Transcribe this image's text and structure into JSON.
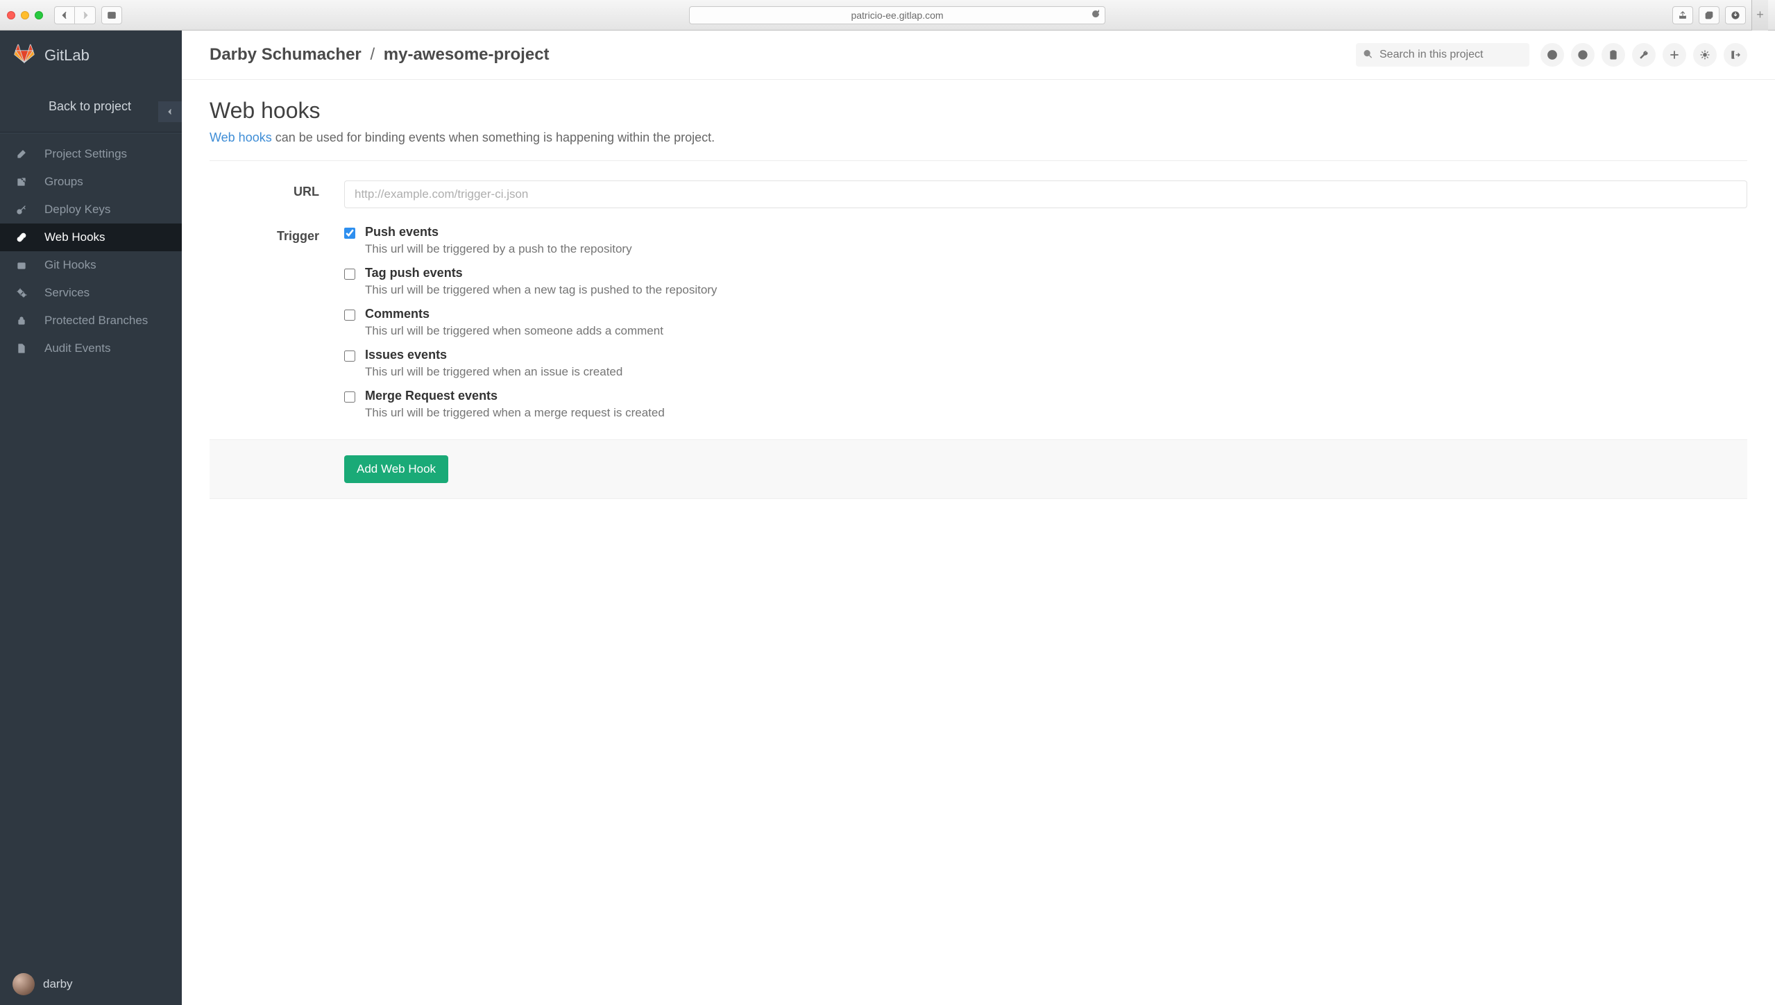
{
  "browser": {
    "url": "patricio-ee.gitlap.com"
  },
  "sidebar": {
    "brand": "GitLab",
    "back_label": "Back to project",
    "items": [
      {
        "icon": "edit-icon",
        "label": "Project Settings"
      },
      {
        "icon": "share-icon",
        "label": "Groups"
      },
      {
        "icon": "key-icon",
        "label": "Deploy Keys"
      },
      {
        "icon": "link-icon",
        "label": "Web Hooks",
        "active": true
      },
      {
        "icon": "hook-icon",
        "label": "Git Hooks"
      },
      {
        "icon": "cogs-icon",
        "label": "Services"
      },
      {
        "icon": "lock-icon",
        "label": "Protected Branches"
      },
      {
        "icon": "file-icon",
        "label": "Audit Events"
      }
    ],
    "user": "darby"
  },
  "topbar": {
    "breadcrumb_owner": "Darby Schumacher",
    "breadcrumb_project": "my-awesome-project",
    "search_placeholder": "Search in this project",
    "icon_buttons": [
      "help-icon",
      "globe-icon",
      "clipboard-icon",
      "wrench-icon",
      "plus-icon",
      "gear-icon",
      "logout-icon"
    ]
  },
  "page": {
    "title": "Web hooks",
    "subtitle_link": "Web hooks",
    "subtitle_rest": " can be used for binding events when something is happening within the project.",
    "form": {
      "url_label": "URL",
      "url_placeholder": "http://example.com/trigger-ci.json",
      "trigger_label": "Trigger",
      "submit_label": "Add Web Hook",
      "triggers": [
        {
          "checked": true,
          "title": "Push events",
          "desc": "This url will be triggered by a push to the repository"
        },
        {
          "checked": false,
          "title": "Tag push events",
          "desc": "This url will be triggered when a new tag is pushed to the repository"
        },
        {
          "checked": false,
          "title": "Comments",
          "desc": "This url will be triggered when someone adds a comment"
        },
        {
          "checked": false,
          "title": "Issues events",
          "desc": "This url will be triggered when an issue is created"
        },
        {
          "checked": false,
          "title": "Merge Request events",
          "desc": "This url will be triggered when a merge request is created"
        }
      ]
    }
  }
}
